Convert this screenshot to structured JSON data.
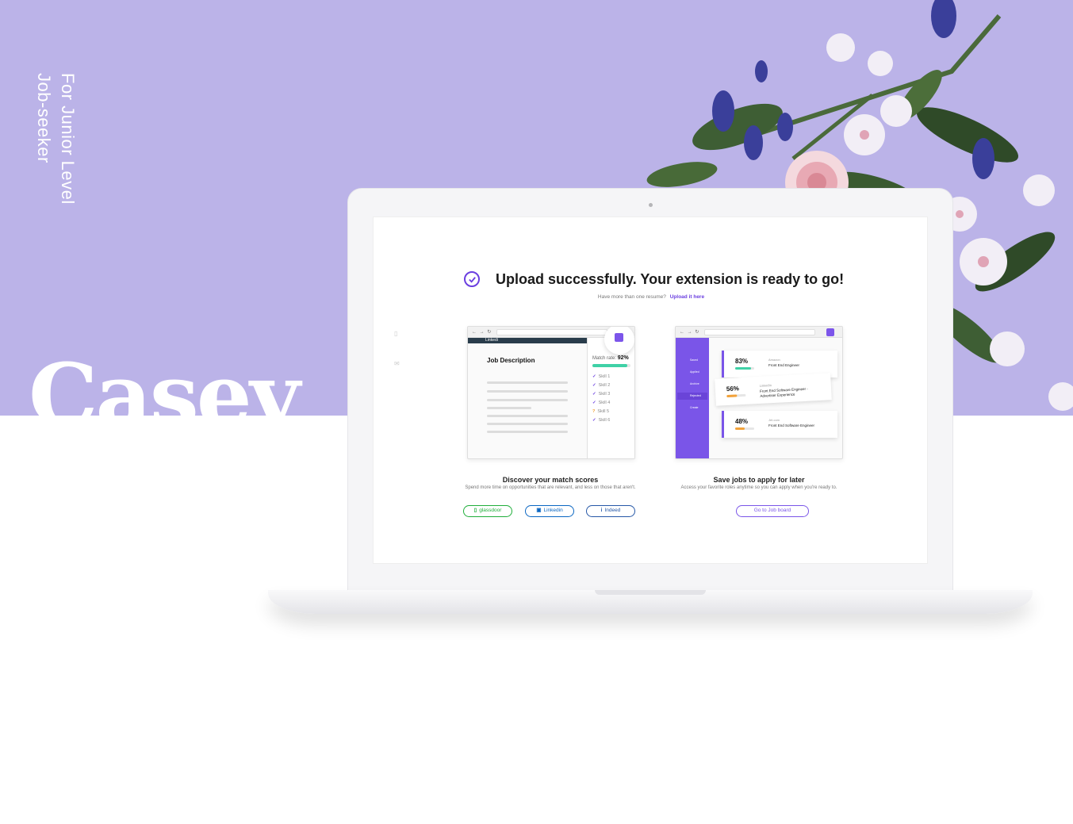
{
  "hero": {
    "tagline_line1": "For Junior Level",
    "tagline_line2": "Job-seeker",
    "brand": "Casey"
  },
  "colors": {
    "background_purple": "#bbb3e8",
    "accent_purple": "#6b3fe0",
    "match_green": "#3fd1a6",
    "glassdoor_green": "#1fae3a",
    "linkedin_blue": "#0a66c2",
    "indeed_blue": "#2557a7"
  },
  "screen": {
    "headline": "Upload successfully. Your extension is ready to go!",
    "sub_prompt": "Have more than one resume?",
    "sub_link": "Upload it here",
    "left_card": {
      "site_tab": "Linkedi",
      "job_description_title": "Job Description",
      "match_rate_label": "Match rate:",
      "match_rate_value": "92%",
      "match_rate_fraction": 0.92,
      "skills": [
        "Skill 1",
        "Skill 2",
        "Skill 3",
        "Skill 4",
        "Skill 5",
        "Skill 6"
      ],
      "skill_marks": [
        "check",
        "check",
        "check",
        "check",
        "question",
        "check"
      ]
    },
    "right_card": {
      "sidebar_items": [
        "Saved",
        "Applied",
        "Archive",
        "Rejected",
        "Create"
      ],
      "jobs": [
        {
          "percent": "83%",
          "fraction": 0.83,
          "company": "Amazon",
          "role": "Front End Engineer",
          "bar_color": "#3fd1a6"
        },
        {
          "percent": "56%",
          "fraction": 0.56,
          "company": "LinkedIn",
          "role": "Front End Software Engineer - Advertiser Experience",
          "bar_color": "#f2a23a"
        },
        {
          "percent": "48%",
          "fraction": 0.48,
          "company": "Jet.com",
          "role": "Front End Software Engineer",
          "bar_color": "#f2a23a"
        }
      ]
    },
    "feature_left": {
      "title": "Discover your match scores",
      "description": "Spend more time on opportunities that are relevant, and less on those that aren't."
    },
    "feature_right": {
      "title": "Save jobs to apply for later",
      "description": "Access your favorite roles anytime so you can apply when you're ready to."
    },
    "buttons": {
      "glassdoor": "glassdoor",
      "linkedin": "Linkedin",
      "indeed": "Indeed",
      "job_board": "Go to Job board"
    }
  }
}
